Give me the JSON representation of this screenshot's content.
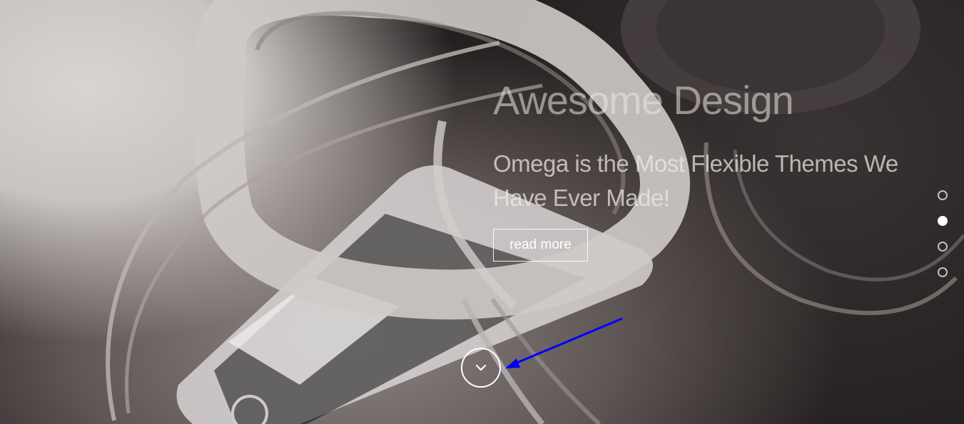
{
  "hero": {
    "title": "Awesome Design",
    "subtitle": "Omega is the Most Flexible Themes We Have Ever Made!",
    "button_label": "read more"
  },
  "slider": {
    "dot_count": 4,
    "active_index": 1
  },
  "icons": {
    "scroll": "chevron-down-icon"
  },
  "colors": {
    "annotation_arrow": "#0000ff",
    "text": "#ffffff"
  }
}
